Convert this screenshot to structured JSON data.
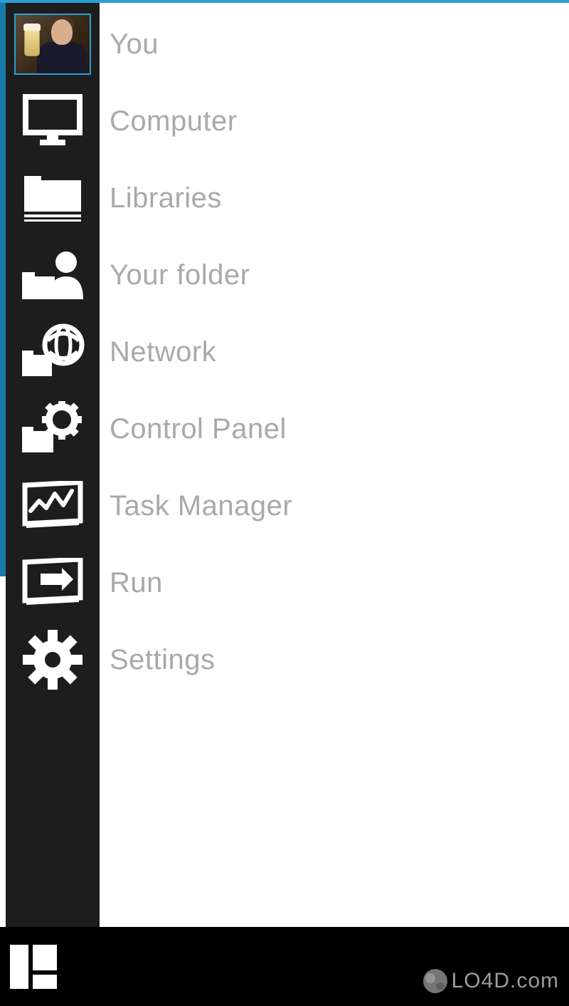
{
  "menu": {
    "items": [
      {
        "id": "you",
        "label": "You",
        "icon": "avatar"
      },
      {
        "id": "computer",
        "label": "Computer",
        "icon": "computer-icon"
      },
      {
        "id": "libraries",
        "label": "Libraries",
        "icon": "libraries-icon"
      },
      {
        "id": "your-folder",
        "label": "Your folder",
        "icon": "user-folder-icon"
      },
      {
        "id": "network",
        "label": "Network",
        "icon": "network-icon"
      },
      {
        "id": "control-panel",
        "label": "Control Panel",
        "icon": "control-panel-icon"
      },
      {
        "id": "task-manager",
        "label": "Task Manager",
        "icon": "task-manager-icon"
      },
      {
        "id": "run",
        "label": "Run",
        "icon": "run-icon"
      },
      {
        "id": "settings",
        "label": "Settings",
        "icon": "settings-icon"
      }
    ]
  },
  "taskbar": {
    "start_icon": "start-tiles-icon"
  },
  "watermark": {
    "text": "LO4D.com"
  }
}
